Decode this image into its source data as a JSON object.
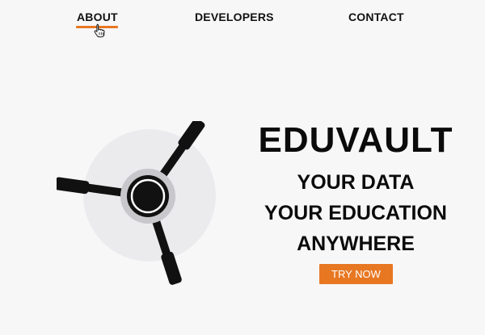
{
  "nav": {
    "items": [
      {
        "label": "ABOUT",
        "active": true
      },
      {
        "label": "DEVELOPERS"
      },
      {
        "label": "CONTACT"
      }
    ],
    "accent_color": "#e87722"
  },
  "hero": {
    "title": "EDUVAULT",
    "tagline_lines": [
      "YOUR DATA",
      "YOUR EDUCATION",
      "ANYWHERE"
    ],
    "cta_label": "TRY NOW",
    "graphic_icon": "vault-handle-icon"
  },
  "colors": {
    "accent": "#e87722",
    "text": "#0b0b0b",
    "background": "#f7f7f8"
  }
}
